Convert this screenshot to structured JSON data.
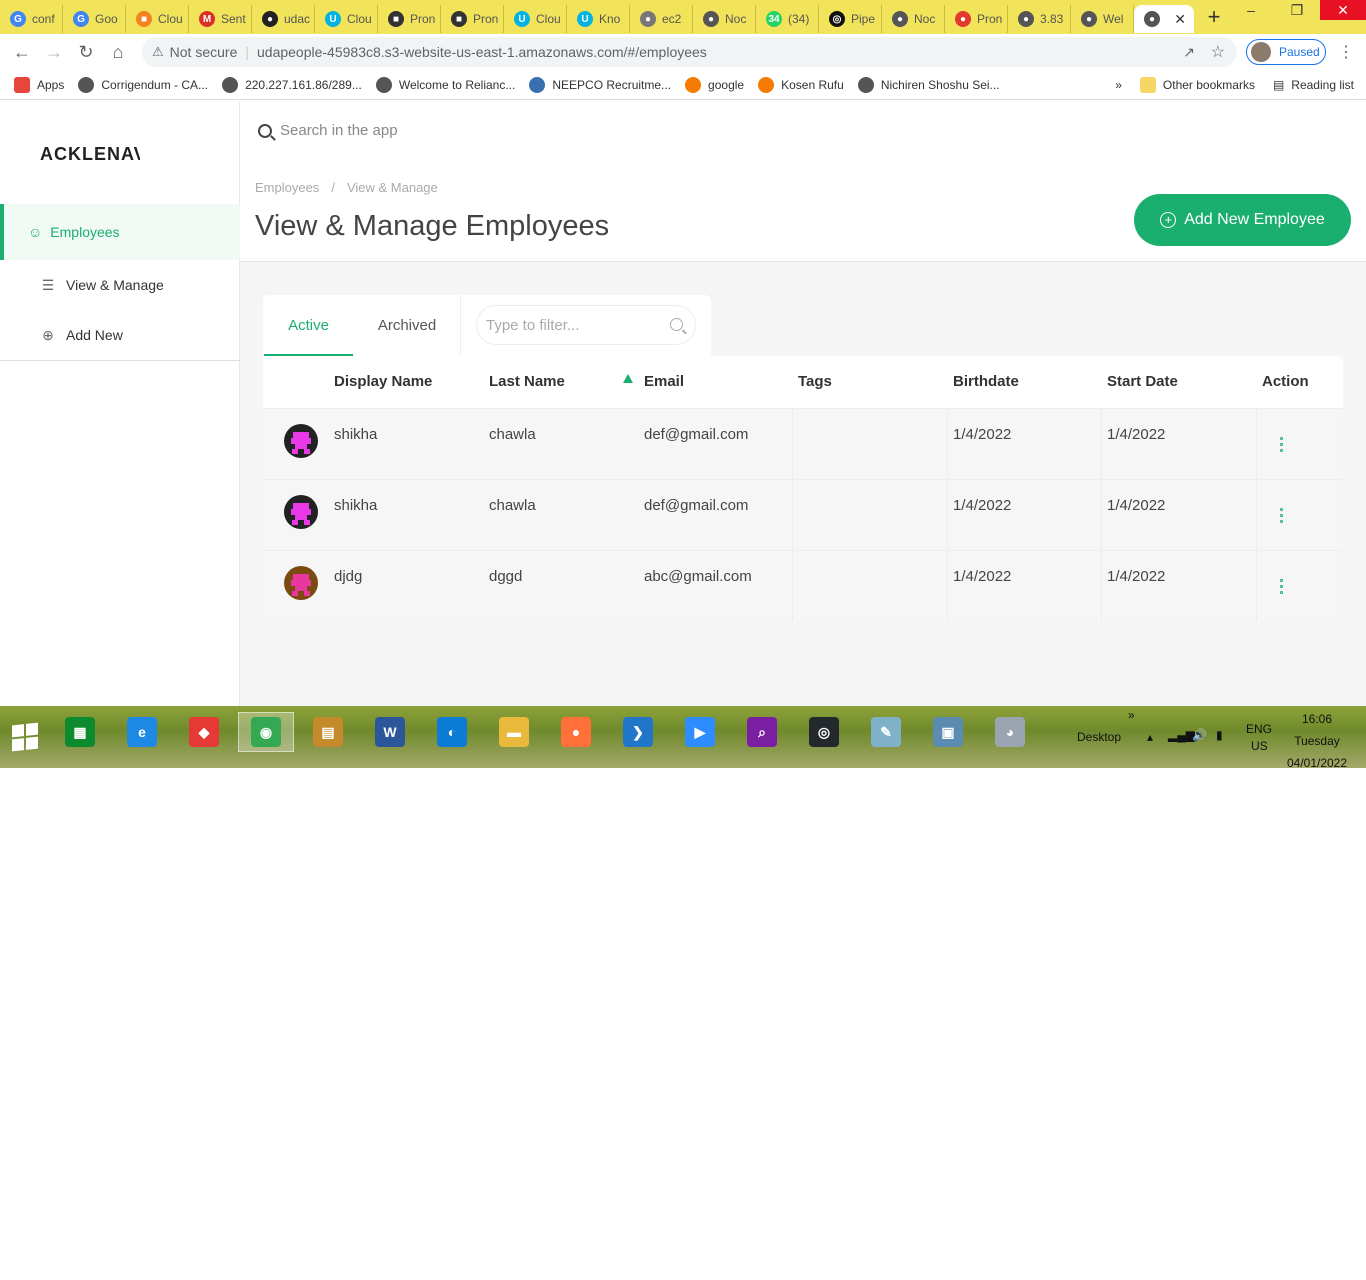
{
  "browser": {
    "tabs": [
      {
        "label": "conf",
        "color": "#4285f4",
        "glyph": "G"
      },
      {
        "label": "Goo",
        "color": "#4285f4",
        "glyph": "G"
      },
      {
        "label": "Clou",
        "color": "#f58220",
        "glyph": "■"
      },
      {
        "label": "Sent",
        "color": "#d93025",
        "glyph": "M"
      },
      {
        "label": "udac",
        "color": "#222222",
        "glyph": "●"
      },
      {
        "label": "Clou",
        "color": "#02b3e4",
        "glyph": "U"
      },
      {
        "label": "Pron",
        "color": "#333333",
        "glyph": "■"
      },
      {
        "label": "Pron",
        "color": "#333333",
        "glyph": "■"
      },
      {
        "label": "Clou",
        "color": "#02b3e4",
        "glyph": "U"
      },
      {
        "label": "Kno",
        "color": "#02b3e4",
        "glyph": "U"
      },
      {
        "label": "ec2",
        "color": "#777777",
        "glyph": "●"
      },
      {
        "label": "Noc",
        "color": "#555555",
        "glyph": "●"
      },
      {
        "label": "(34)",
        "color": "#25d366",
        "glyph": "34"
      },
      {
        "label": "Pipe",
        "color": "#111111",
        "glyph": "◎"
      },
      {
        "label": "Noc",
        "color": "#555555",
        "glyph": "●"
      },
      {
        "label": "Pron",
        "color": "#e23a2e",
        "glyph": "●"
      },
      {
        "label": "3.83",
        "color": "#555555",
        "glyph": "●"
      },
      {
        "label": "Wel",
        "color": "#555555",
        "glyph": "●"
      },
      {
        "label": "",
        "color": "#555555",
        "glyph": "●",
        "active": true
      }
    ],
    "new_tab": "+",
    "window_controls": {
      "minimize": "–",
      "restore": "❐",
      "close": "✕"
    },
    "address": {
      "security_label": "Not secure",
      "url": "udapeople-45983c8.s3-website-us-east-1.amazonaws.com/#/employees"
    },
    "profile_label": "Paused",
    "bookmarks": [
      {
        "label": "Apps",
        "color": "#e8453c"
      },
      {
        "label": "Corrigendum - CA...",
        "color": "#555555"
      },
      {
        "label": "220.227.161.86/289...",
        "color": "#555555"
      },
      {
        "label": "Welcome to Relianc...",
        "color": "#555555"
      },
      {
        "label": "NEEPCO Recruitme...",
        "color": "#3a6fb0"
      },
      {
        "label": "google",
        "color": "#f57c00"
      },
      {
        "label": "Kosen Rufu",
        "color": "#f57c00"
      },
      {
        "label": "Nichiren Shoshu Sei...",
        "color": "#555555"
      }
    ],
    "bookmarks_more": "»",
    "other_bookmarks": "Other bookmarks",
    "reading_list": "Reading list"
  },
  "app": {
    "logo": "ACKLENAVENUE",
    "sidebar": {
      "section": "Employees",
      "items": [
        {
          "label": "View & Manage",
          "icon": "list-icon"
        },
        {
          "label": "Add New",
          "icon": "plus-circle-icon"
        }
      ]
    },
    "search_placeholder": "Search in the app",
    "breadcrumb": {
      "first": "Employees",
      "separator": "/",
      "second": "View & Manage"
    },
    "page_title": "View & Manage Employees",
    "add_button": "Add New Employee",
    "tabs": {
      "active": "Active",
      "archived": "Archived"
    },
    "filter_placeholder": "Type to filter...",
    "table": {
      "columns": [
        "Display Name",
        "Last Name",
        "Email",
        "Tags",
        "Birthdate",
        "Start Date",
        "Action"
      ],
      "sorted_column": "Email",
      "rows": [
        {
          "display_name": "shikha",
          "last_name": "chawla",
          "email": "def@gmail.com",
          "tags": "",
          "birthdate": "1/4/2022",
          "start_date": "1/4/2022"
        },
        {
          "display_name": "shikha",
          "last_name": "chawla",
          "email": "def@gmail.com",
          "tags": "",
          "birthdate": "1/4/2022",
          "start_date": "1/4/2022"
        },
        {
          "display_name": "djdg",
          "last_name": "dggd",
          "email": "abc@gmail.com",
          "tags": "",
          "birthdate": "1/4/2022",
          "start_date": "1/4/2022"
        }
      ]
    },
    "accent_color": "#1aae6f"
  },
  "taskbar": {
    "desktop_label": "Desktop",
    "language": "ENG",
    "region": "US",
    "time": "16:06",
    "day": "Tuesday",
    "date": "04/01/2022",
    "overflow": "»",
    "apps": [
      "store",
      "internet-explorer",
      "anydesk",
      "chrome",
      "archive",
      "word",
      "edge",
      "file-explorer",
      "firefox",
      "vscode",
      "zoom",
      "search-app",
      "github",
      "notepad",
      "photos",
      "paint"
    ]
  }
}
